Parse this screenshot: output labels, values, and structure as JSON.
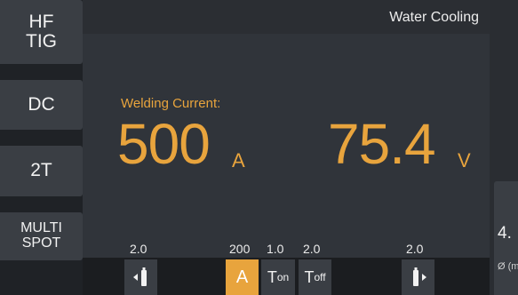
{
  "header": {
    "status": "Water Cooling"
  },
  "side_modes": [
    {
      "lines": [
        "HF",
        "TIG"
      ]
    },
    {
      "lines": [
        "DC"
      ]
    },
    {
      "lines": [
        "2T"
      ]
    },
    {
      "lines": [
        "MULTI",
        "SPOT"
      ]
    }
  ],
  "main": {
    "label": "Welding Current:",
    "current_value": "500",
    "current_unit": "A",
    "voltage_value": "75.4",
    "voltage_unit": "V"
  },
  "right_panel": {
    "value": "4.",
    "diameter_label": "Ø (m"
  },
  "params": {
    "pre_gas": "2.0",
    "current": "200",
    "t_on": "1.0",
    "t_off": "2.0",
    "post_gas": "2.0"
  },
  "toolbar": {
    "amp_label": "A",
    "ton_main": "T",
    "ton_sub": "on",
    "toff_main": "T",
    "toff_sub": "off"
  },
  "colors": {
    "accent": "#e8a43d",
    "panel": "#30343a",
    "button": "#3a3e44"
  }
}
